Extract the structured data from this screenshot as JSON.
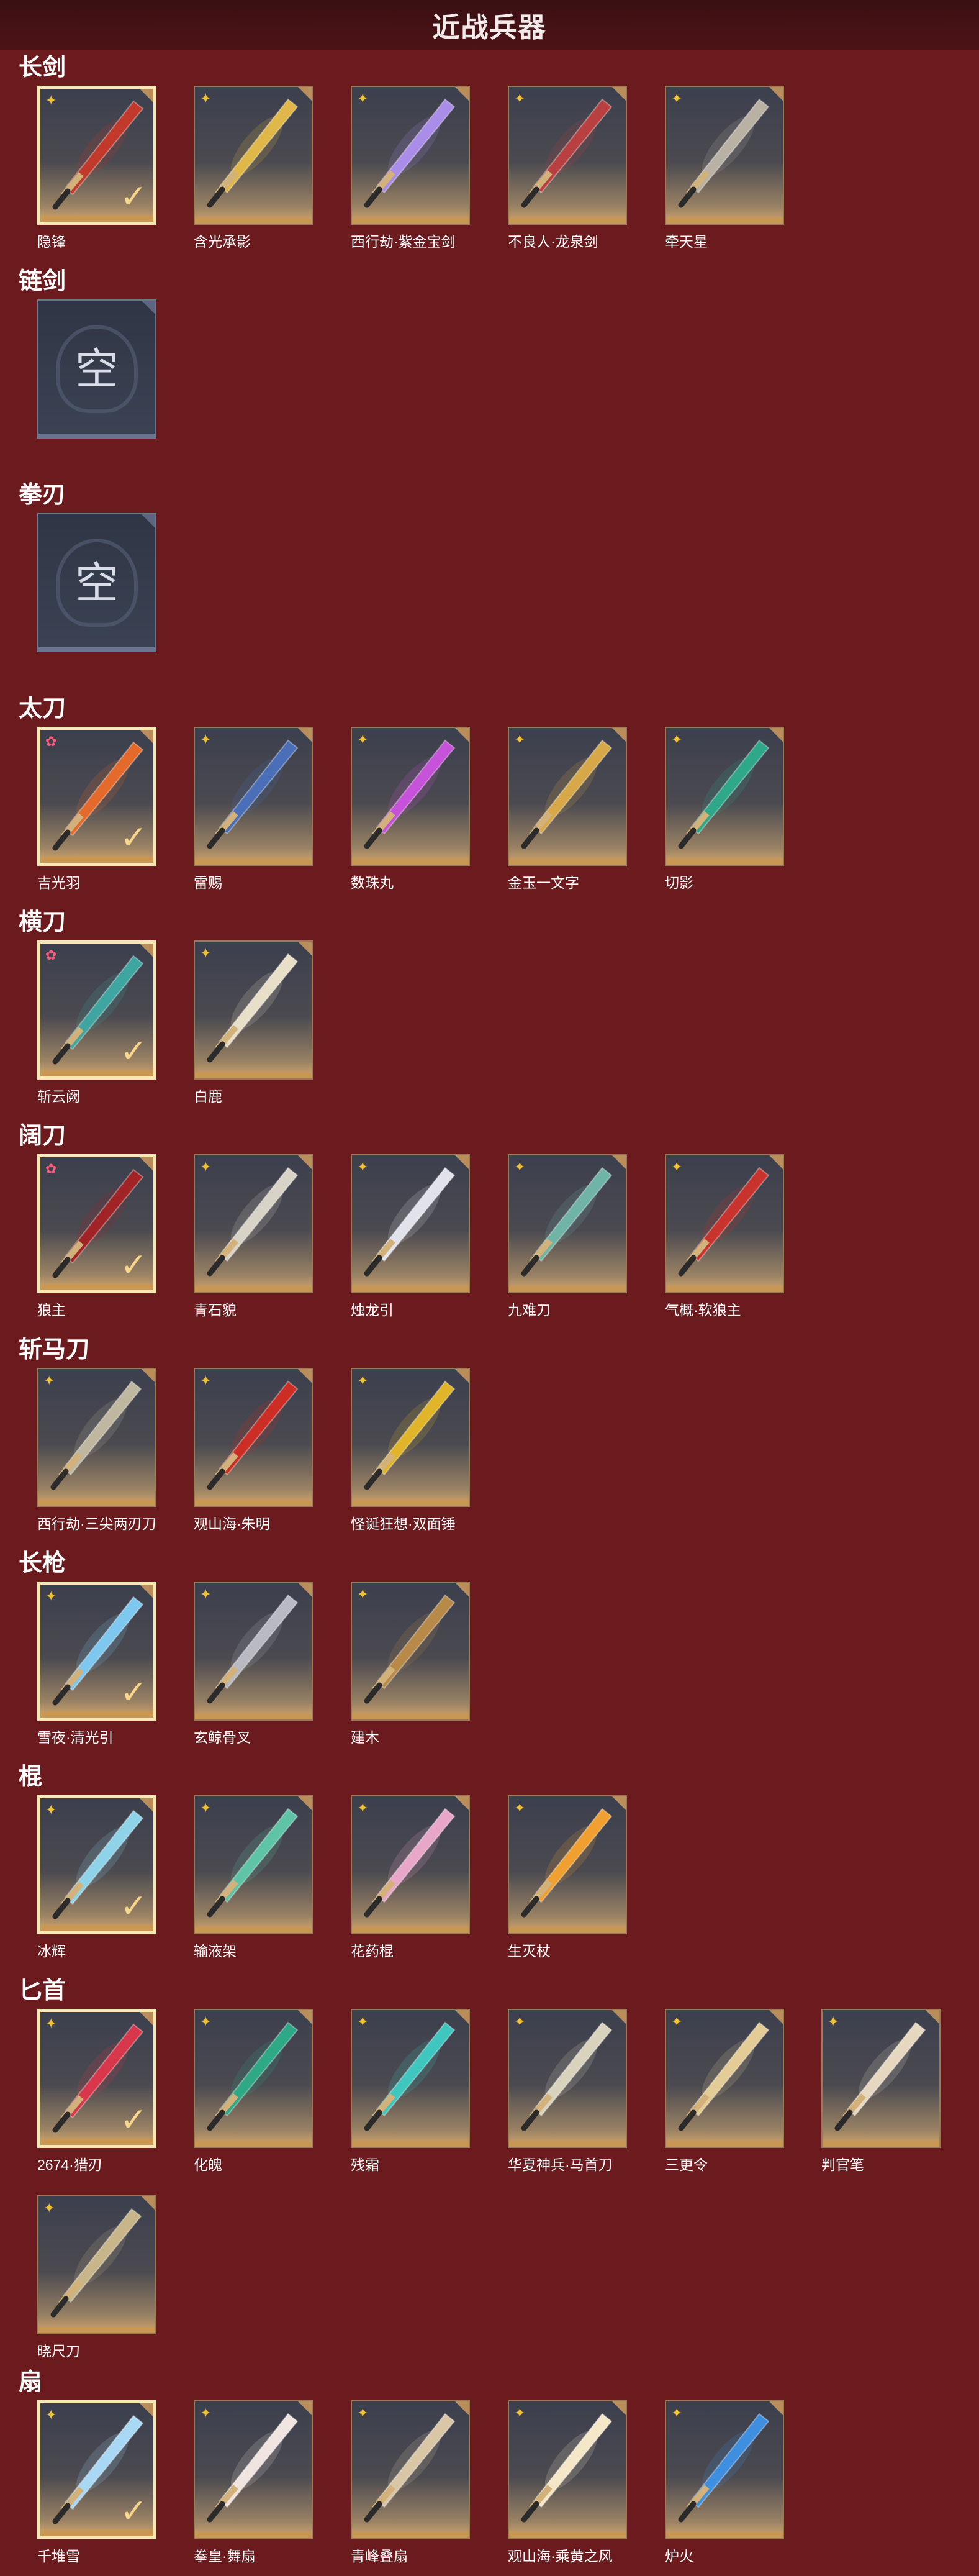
{
  "page_title": "近战兵器",
  "empty_text": "空",
  "sections": [
    {
      "title": "长剑",
      "items": [
        {
          "name": "隐锋",
          "badge": "gold",
          "selected": true,
          "color": "#c0392b"
        },
        {
          "name": "含光承影",
          "badge": "gold",
          "selected": false,
          "color": "#e0b84a"
        },
        {
          "name": "西行劫·紫金宝剑",
          "badge": "gold",
          "selected": false,
          "color": "#a98de8"
        },
        {
          "name": "不良人·龙泉剑",
          "badge": "gold",
          "selected": false,
          "color": "#b84040"
        },
        {
          "name": "牵天星",
          "badge": "gold",
          "selected": false,
          "color": "#b9b2a4"
        }
      ]
    },
    {
      "title": "链剑",
      "items": [
        {
          "name": "",
          "empty": true
        }
      ]
    },
    {
      "title": "拳刃",
      "items": [
        {
          "name": "",
          "empty": true
        }
      ]
    },
    {
      "title": "太刀",
      "items": [
        {
          "name": "吉光羽",
          "badge": "pink",
          "selected": true,
          "color": "#e46a2c"
        },
        {
          "name": "雷赐",
          "badge": "gold",
          "selected": false,
          "color": "#4a6fb8"
        },
        {
          "name": "数珠丸",
          "badge": "gold",
          "selected": false,
          "color": "#c552d8"
        },
        {
          "name": "金玉一文字",
          "badge": "gold",
          "selected": false,
          "color": "#d6a848"
        },
        {
          "name": "切影",
          "badge": "gold",
          "selected": false,
          "color": "#2ea889"
        }
      ]
    },
    {
      "title": "横刀",
      "items": [
        {
          "name": "斩云阙",
          "badge": "pink",
          "selected": true,
          "color": "#3fa5a0"
        },
        {
          "name": "白鹿",
          "badge": "gold",
          "selected": false,
          "color": "#e8dfc8"
        }
      ]
    },
    {
      "title": "阔刀",
      "items": [
        {
          "name": "狼主",
          "badge": "pink",
          "selected": true,
          "color": "#a02426"
        },
        {
          "name": "青石貌",
          "badge": "gold",
          "selected": false,
          "color": "#d9d2c6"
        },
        {
          "name": "烛龙引",
          "badge": "gold",
          "selected": false,
          "color": "#e2e2ea"
        },
        {
          "name": "九难刀",
          "badge": "gold",
          "selected": false,
          "color": "#6fb4a6"
        },
        {
          "name": "气概·软狼主",
          "badge": "gold",
          "selected": false,
          "color": "#c9332d"
        }
      ]
    },
    {
      "title": "斩马刀",
      "items": [
        {
          "name": "西行劫·三尖两刃刀",
          "badge": "gold",
          "selected": false,
          "color": "#bfb79f"
        },
        {
          "name": "观山海·朱明",
          "badge": "gold",
          "selected": false,
          "color": "#cc2d24"
        },
        {
          "name": "怪诞狂想·双面锤",
          "badge": "gold",
          "selected": false,
          "color": "#e0b52a"
        }
      ]
    },
    {
      "title": "长枪",
      "items": [
        {
          "name": "雪夜·清光引",
          "badge": "gold",
          "selected": true,
          "color": "#7ec8f0"
        },
        {
          "name": "玄鲸骨叉",
          "badge": "gold",
          "selected": false,
          "color": "#b9b9c4"
        },
        {
          "name": "建木",
          "badge": "gold",
          "selected": false,
          "color": "#b88a4a"
        }
      ]
    },
    {
      "title": "棍",
      "items": [
        {
          "name": "冰辉",
          "badge": "gold",
          "selected": true,
          "color": "#8fd3e8"
        },
        {
          "name": "输液架",
          "badge": "gold",
          "selected": false,
          "color": "#5fc4a6"
        },
        {
          "name": "花药棍",
          "badge": "gold",
          "selected": false,
          "color": "#e8a7c8"
        },
        {
          "name": "生灭杖",
          "badge": "gold",
          "selected": false,
          "color": "#f0a030"
        }
      ]
    },
    {
      "title": "匕首",
      "items": [
        {
          "name": "2674·猎刃",
          "badge": "gold",
          "selected": true,
          "color": "#d8364a"
        },
        {
          "name": "化魄",
          "badge": "gold",
          "selected": false,
          "color": "#2fa886"
        },
        {
          "name": "残霜",
          "badge": "gold",
          "selected": false,
          "color": "#3fc7bf"
        },
        {
          "name": "华夏神兵·马首刀",
          "badge": "gold",
          "selected": false,
          "color": "#d9d2bc"
        },
        {
          "name": "三更令",
          "badge": "gold",
          "selected": false,
          "color": "#e3cc95"
        },
        {
          "name": "判官笔",
          "badge": "gold",
          "selected": false,
          "color": "#e6d8c0"
        },
        {
          "name": "晓尺刀",
          "badge": "gold",
          "selected": false,
          "color": "#c8b68a"
        }
      ]
    },
    {
      "title": "扇",
      "items": [
        {
          "name": "千堆雪",
          "badge": "gold",
          "selected": true,
          "color": "#a8d8f3"
        },
        {
          "name": "拳皇·舞扇",
          "badge": "gold",
          "selected": false,
          "color": "#f0e4e0"
        },
        {
          "name": "青峰叠扇",
          "badge": "gold",
          "selected": false,
          "color": "#d8c6a6"
        },
        {
          "name": "观山海·乘黄之风",
          "badge": "gold",
          "selected": false,
          "color": "#f4e7c8"
        },
        {
          "name": "炉火",
          "badge": "gold",
          "selected": false,
          "color": "#3f8fe0"
        }
      ]
    }
  ],
  "colors": {
    "background": "#6b1a1e",
    "header": "#3a1013",
    "card_border": "#9c7a58",
    "selected_border": "#f5e7b6",
    "badge_gold": "#f1c232",
    "badge_pink": "#ff5b7d"
  }
}
